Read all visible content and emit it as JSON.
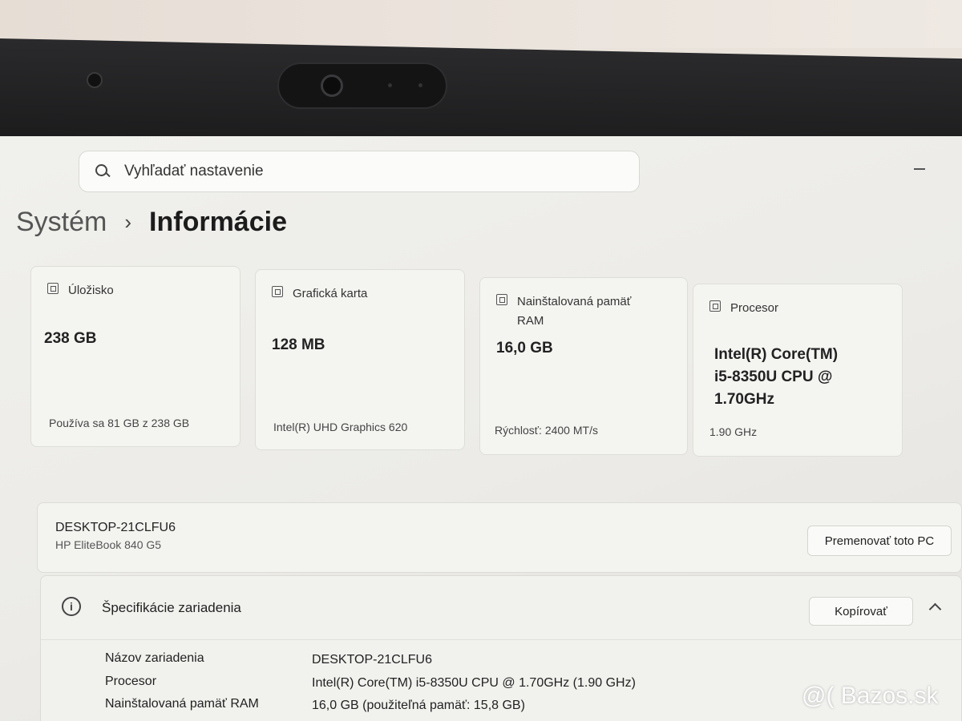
{
  "search": {
    "placeholder": "Vyhľadať nastavenie"
  },
  "breadcrumb": {
    "parent": "Systém",
    "separator": "›",
    "current": "Informácie"
  },
  "cards": [
    {
      "label": "Úložisko",
      "value": "238 GB",
      "sub": "Používa sa 81 GB z 238 GB",
      "icon": "storage-icon"
    },
    {
      "label": "Grafická karta",
      "value": "128 MB",
      "sub": "Intel(R) UHD Graphics 620",
      "icon": "graphics-card-icon"
    },
    {
      "label_line1": "Nainštalovaná pamäť",
      "label_line2": "RAM",
      "value": "16,0 GB",
      "sub": "Rýchlosť: 2400 MT/s",
      "icon": "memory-icon"
    },
    {
      "label": "Procesor",
      "value_line1": "Intel(R) Core(TM)",
      "value_line2": "i5-8350U CPU @",
      "value_line3": "1.70GHz",
      "sub": "1.90 GHz",
      "icon": "processor-icon"
    }
  ],
  "device": {
    "name": "DESKTOP-21CLFU6",
    "model": "HP EliteBook 840 G5",
    "rename_label": "Premenovať toto PC"
  },
  "specs": {
    "title": "Špecifikácie zariadenia",
    "copy_label": "Kopírovať",
    "rows": [
      {
        "label": "Názov zariadenia",
        "value": "DESKTOP-21CLFU6"
      },
      {
        "label": "Procesor",
        "value": "Intel(R) Core(TM) i5-8350U CPU @ 1.70GHz (1.90 GHz)"
      },
      {
        "label": "Nainštalovaná pamäť RAM",
        "value": "16,0 GB (použiteľná pamäť: 15,8 GB)"
      }
    ]
  },
  "watermark": "@( Bazos.sk"
}
